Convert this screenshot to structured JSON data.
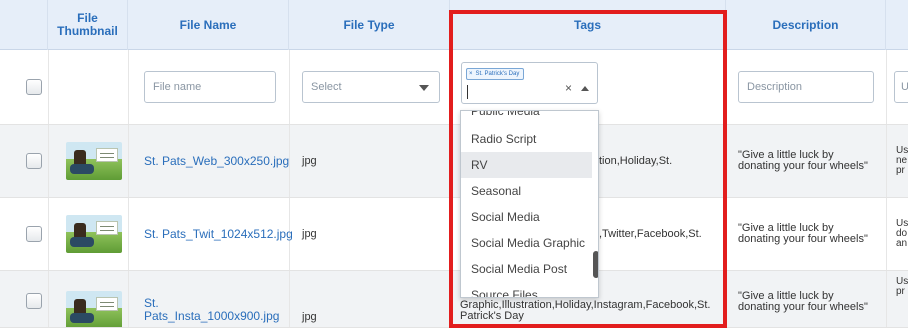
{
  "headers": {
    "thumbnail": "File Thumbnail",
    "file_name": "File Name",
    "file_type": "File Type",
    "tags": "Tags",
    "description": "Description"
  },
  "filters": {
    "file_name_placeholder": "File name",
    "file_type_placeholder": "Select",
    "description_placeholder": "Description",
    "last_placeholder": "U",
    "selected_tag": "St. Patrick's Day",
    "chip_remove": "×",
    "clear": "×"
  },
  "dropdown": {
    "options": [
      "Public Media",
      "Radio Script",
      "RV",
      "Seasonal",
      "Social Media",
      "Social Media Graphic",
      "Social Media Post",
      "Source Files"
    ],
    "highlighted": "RV"
  },
  "rows": [
    {
      "file_name": "St. Pats_Web_300x250.jpg",
      "file_type": "jpg",
      "tags_visible": "tion,Holiday,St.",
      "description": "\"Give a little luck by donating your four wheels\"",
      "last_col": "Us we ne yo pr"
    },
    {
      "file_name": "St. Pats_Twit_1024x512.jpg",
      "file_type": "jpg",
      "tags_visible": ",Twitter,Facebook,St.",
      "description": "\"Give a little luck by donating your four wheels\"",
      "last_col": "Us pr do or an"
    },
    {
      "file_name": "St. Pats_Insta_1000x900.jpg",
      "file_type": "jpg",
      "tags_visible": "Social Media Graphic,Illustration,Holiday,Instagram,Facebook,St. Patrick's Day",
      "description": "\"Give a little luck by donating your four wheels\"",
      "last_col": "Us yo pr or"
    }
  ],
  "colors": {
    "accent": "#2a6ebb",
    "highlight_frame": "#e21d1d",
    "header_bg": "#e6eef9"
  }
}
